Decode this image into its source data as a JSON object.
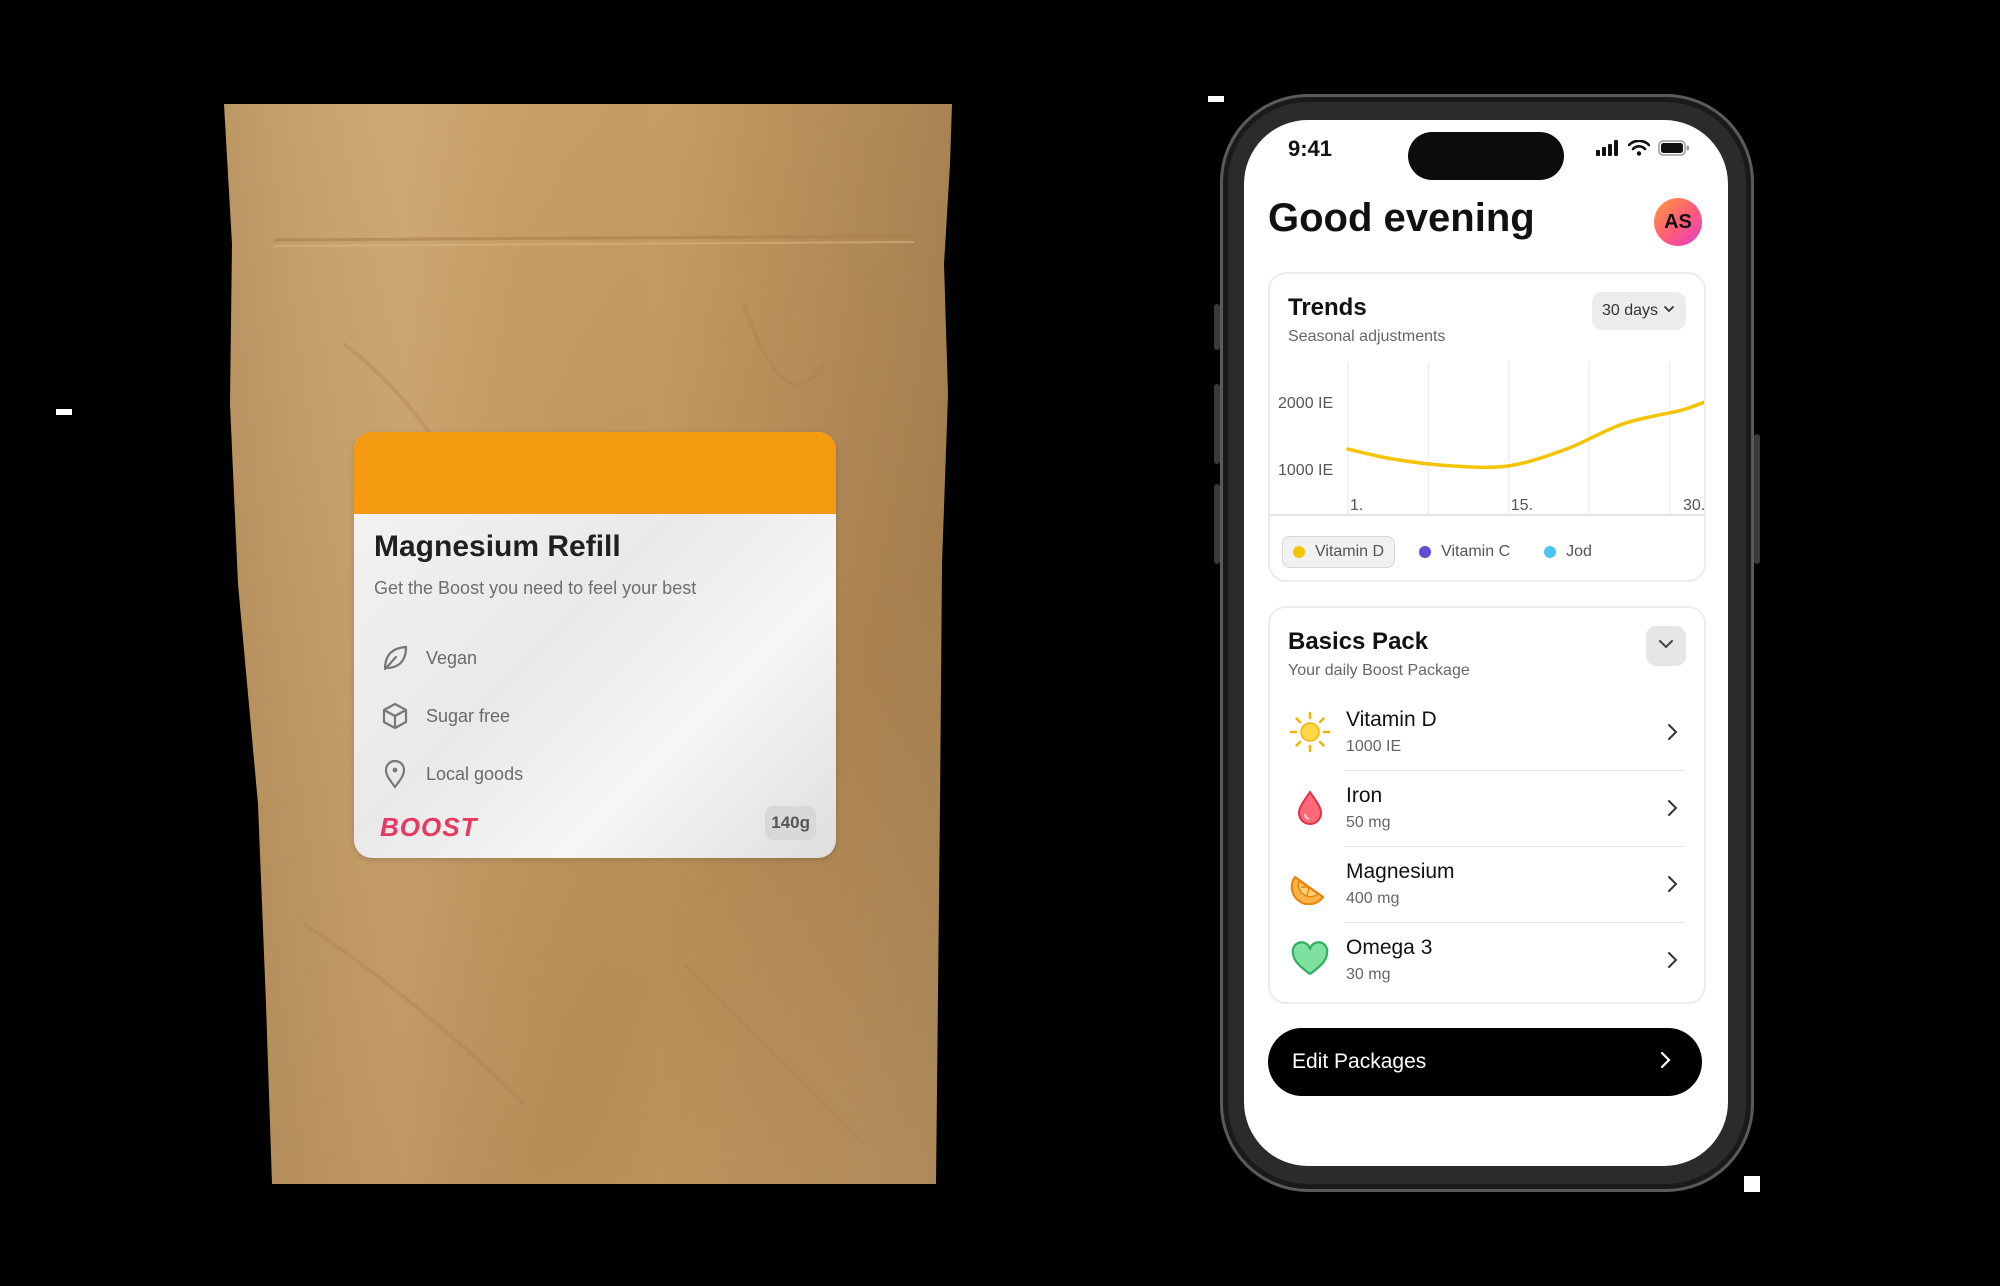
{
  "pouch": {
    "title": "Magnesium Refill",
    "subtitle": "Get the Boost you need to feel your best",
    "features": [
      {
        "label": "Vegan",
        "icon": "leaf-icon"
      },
      {
        "label": "Sugar free",
        "icon": "cube-icon"
      },
      {
        "label": "Local goods",
        "icon": "location-pin-icon"
      }
    ],
    "brand": "BOOST",
    "weight": "140g",
    "colors": {
      "band": "#f39a10",
      "brand": "#e8385f",
      "kraft": "#c39a63"
    }
  },
  "phone": {
    "status": {
      "time": "9:41"
    },
    "greeting": "Good evening",
    "avatar_initials": "AS",
    "trends": {
      "title": "Trends",
      "subtitle": "Seasonal adjustments",
      "range_label": "30 days",
      "legend": [
        {
          "label": "Vitamin D",
          "color": "#f5c400",
          "active": true
        },
        {
          "label": "Vitamin C",
          "color": "#5b4fd6",
          "active": false
        },
        {
          "label": "Jod",
          "color": "#4cc3f0",
          "active": false
        }
      ]
    },
    "pack": {
      "title": "Basics Pack",
      "subtitle": "Your daily Boost Package",
      "items": [
        {
          "name": "Vitamin D",
          "dose": "1000 IE",
          "icon": "sun-icon"
        },
        {
          "name": "Iron",
          "dose": "50 mg",
          "icon": "drop-icon"
        },
        {
          "name": "Magnesium",
          "dose": "400 mg",
          "icon": "orange-slice-icon"
        },
        {
          "name": "Omega 3",
          "dose": "30 mg",
          "icon": "heart-icon"
        }
      ]
    },
    "cta_label": "Edit Packages"
  },
  "chart_data": {
    "type": "line",
    "title": "Trends",
    "subtitle": "Seasonal adjustments",
    "xlabel": "",
    "ylabel": "",
    "x_ticks": [
      "1.",
      "15.",
      "30."
    ],
    "y_ticks": [
      "1000 IE",
      "2000 IE"
    ],
    "grid": true,
    "series": [
      {
        "name": "Vitamin D",
        "color": "#f5c400",
        "x": [
          1,
          5,
          10,
          15,
          20,
          25,
          30,
          32
        ],
        "y": [
          1300,
          1150,
          1050,
          1050,
          1300,
          1680,
          1880,
          2000
        ]
      }
    ]
  }
}
